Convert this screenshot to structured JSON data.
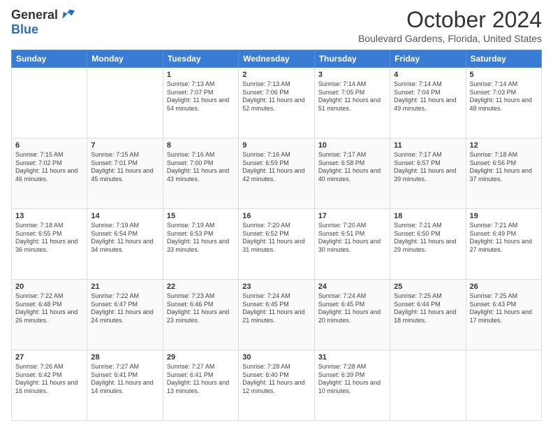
{
  "logo": {
    "general": "General",
    "blue": "Blue"
  },
  "header": {
    "month": "October 2024",
    "location": "Boulevard Gardens, Florida, United States"
  },
  "weekdays": [
    "Sunday",
    "Monday",
    "Tuesday",
    "Wednesday",
    "Thursday",
    "Friday",
    "Saturday"
  ],
  "weeks": [
    [
      {
        "day": "",
        "info": ""
      },
      {
        "day": "",
        "info": ""
      },
      {
        "day": "1",
        "info": "Sunrise: 7:13 AM\nSunset: 7:07 PM\nDaylight: 11 hours and 54 minutes."
      },
      {
        "day": "2",
        "info": "Sunrise: 7:13 AM\nSunset: 7:06 PM\nDaylight: 11 hours and 52 minutes."
      },
      {
        "day": "3",
        "info": "Sunrise: 7:14 AM\nSunset: 7:05 PM\nDaylight: 11 hours and 51 minutes."
      },
      {
        "day": "4",
        "info": "Sunrise: 7:14 AM\nSunset: 7:04 PM\nDaylight: 11 hours and 49 minutes."
      },
      {
        "day": "5",
        "info": "Sunrise: 7:14 AM\nSunset: 7:03 PM\nDaylight: 11 hours and 48 minutes."
      }
    ],
    [
      {
        "day": "6",
        "info": "Sunrise: 7:15 AM\nSunset: 7:02 PM\nDaylight: 11 hours and 46 minutes."
      },
      {
        "day": "7",
        "info": "Sunrise: 7:15 AM\nSunset: 7:01 PM\nDaylight: 11 hours and 45 minutes."
      },
      {
        "day": "8",
        "info": "Sunrise: 7:16 AM\nSunset: 7:00 PM\nDaylight: 11 hours and 43 minutes."
      },
      {
        "day": "9",
        "info": "Sunrise: 7:16 AM\nSunset: 6:59 PM\nDaylight: 11 hours and 42 minutes."
      },
      {
        "day": "10",
        "info": "Sunrise: 7:17 AM\nSunset: 6:58 PM\nDaylight: 11 hours and 40 minutes."
      },
      {
        "day": "11",
        "info": "Sunrise: 7:17 AM\nSunset: 6:57 PM\nDaylight: 11 hours and 39 minutes."
      },
      {
        "day": "12",
        "info": "Sunrise: 7:18 AM\nSunset: 6:56 PM\nDaylight: 11 hours and 37 minutes."
      }
    ],
    [
      {
        "day": "13",
        "info": "Sunrise: 7:18 AM\nSunset: 6:55 PM\nDaylight: 11 hours and 36 minutes."
      },
      {
        "day": "14",
        "info": "Sunrise: 7:19 AM\nSunset: 6:54 PM\nDaylight: 11 hours and 34 minutes."
      },
      {
        "day": "15",
        "info": "Sunrise: 7:19 AM\nSunset: 6:53 PM\nDaylight: 11 hours and 33 minutes."
      },
      {
        "day": "16",
        "info": "Sunrise: 7:20 AM\nSunset: 6:52 PM\nDaylight: 11 hours and 31 minutes."
      },
      {
        "day": "17",
        "info": "Sunrise: 7:20 AM\nSunset: 6:51 PM\nDaylight: 11 hours and 30 minutes."
      },
      {
        "day": "18",
        "info": "Sunrise: 7:21 AM\nSunset: 6:50 PM\nDaylight: 11 hours and 29 minutes."
      },
      {
        "day": "19",
        "info": "Sunrise: 7:21 AM\nSunset: 6:49 PM\nDaylight: 11 hours and 27 minutes."
      }
    ],
    [
      {
        "day": "20",
        "info": "Sunrise: 7:22 AM\nSunset: 6:48 PM\nDaylight: 11 hours and 26 minutes."
      },
      {
        "day": "21",
        "info": "Sunrise: 7:22 AM\nSunset: 6:47 PM\nDaylight: 11 hours and 24 minutes."
      },
      {
        "day": "22",
        "info": "Sunrise: 7:23 AM\nSunset: 6:46 PM\nDaylight: 11 hours and 23 minutes."
      },
      {
        "day": "23",
        "info": "Sunrise: 7:24 AM\nSunset: 6:45 PM\nDaylight: 11 hours and 21 minutes."
      },
      {
        "day": "24",
        "info": "Sunrise: 7:24 AM\nSunset: 6:45 PM\nDaylight: 11 hours and 20 minutes."
      },
      {
        "day": "25",
        "info": "Sunrise: 7:25 AM\nSunset: 6:44 PM\nDaylight: 11 hours and 18 minutes."
      },
      {
        "day": "26",
        "info": "Sunrise: 7:25 AM\nSunset: 6:43 PM\nDaylight: 11 hours and 17 minutes."
      }
    ],
    [
      {
        "day": "27",
        "info": "Sunrise: 7:26 AM\nSunset: 6:42 PM\nDaylight: 11 hours and 16 minutes."
      },
      {
        "day": "28",
        "info": "Sunrise: 7:27 AM\nSunset: 6:41 PM\nDaylight: 11 hours and 14 minutes."
      },
      {
        "day": "29",
        "info": "Sunrise: 7:27 AM\nSunset: 6:41 PM\nDaylight: 11 hours and 13 minutes."
      },
      {
        "day": "30",
        "info": "Sunrise: 7:28 AM\nSunset: 6:40 PM\nDaylight: 11 hours and 12 minutes."
      },
      {
        "day": "31",
        "info": "Sunrise: 7:28 AM\nSunset: 6:39 PM\nDaylight: 11 hours and 10 minutes."
      },
      {
        "day": "",
        "info": ""
      },
      {
        "day": "",
        "info": ""
      }
    ]
  ]
}
